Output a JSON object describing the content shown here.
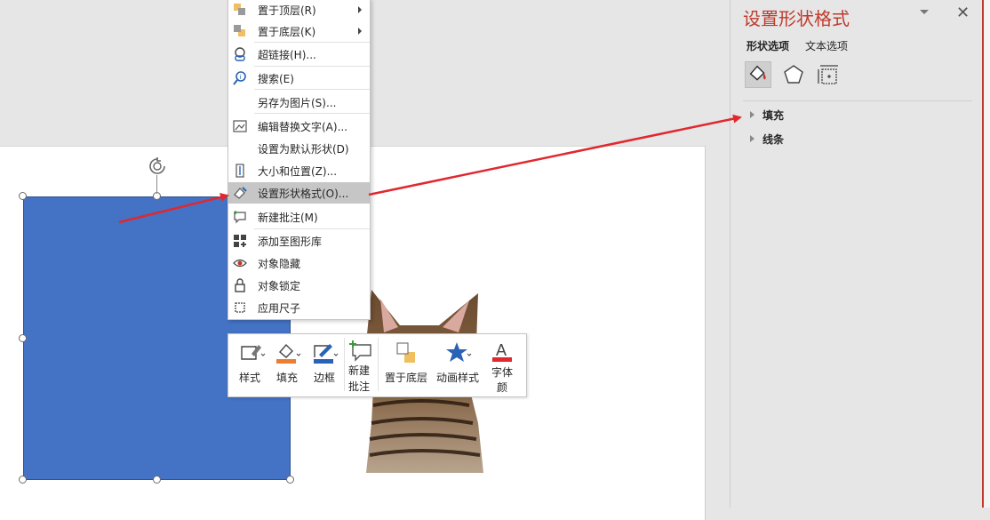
{
  "context_menu": {
    "items": [
      {
        "label": "置于顶层(R)",
        "icon": "bring-front-icon",
        "submenu": true
      },
      {
        "label": "置于底层(K)",
        "icon": "send-back-icon",
        "submenu": true
      },
      {
        "label": "超链接(H)...",
        "icon": "hyperlink-icon"
      },
      {
        "label": "搜索(E)",
        "icon": "search-icon"
      },
      {
        "label": "另存为图片(S)...",
        "icon": ""
      },
      {
        "label": "编辑替换文字(A)...",
        "icon": "alt-text-icon"
      },
      {
        "label": "设置为默认形状(D)",
        "icon": ""
      },
      {
        "label": "大小和位置(Z)...",
        "icon": "size-position-icon"
      },
      {
        "label": "设置形状格式(O)...",
        "icon": "format-shape-icon",
        "active": true
      },
      {
        "label": "新建批注(M)",
        "icon": "new-comment-icon"
      },
      {
        "label": "添加至图形库",
        "icon": "add-gallery-icon"
      },
      {
        "label": "对象隐藏",
        "icon": "eye-icon"
      },
      {
        "label": "对象锁定",
        "icon": "lock-icon"
      },
      {
        "label": "应用尺子",
        "icon": "ruler-icon"
      }
    ]
  },
  "mini_toolbar": {
    "style": "样式",
    "fill": "填充",
    "outline": "边框",
    "new_comment_line1": "新建",
    "new_comment_line2": "批注",
    "send_back": "置于底层",
    "animation": "动画样式",
    "font_color_line1": "字体",
    "font_color_line2": "颜"
  },
  "format_pane": {
    "title": "设置形状格式",
    "tabs": [
      "形状选项",
      "文本选项"
    ],
    "sections": [
      "填充",
      "线条"
    ]
  },
  "colors": {
    "shape_fill": "#4472c4",
    "accent": "#c0392b",
    "arrow": "#e0282e",
    "highlight": "#c6c6c6"
  }
}
